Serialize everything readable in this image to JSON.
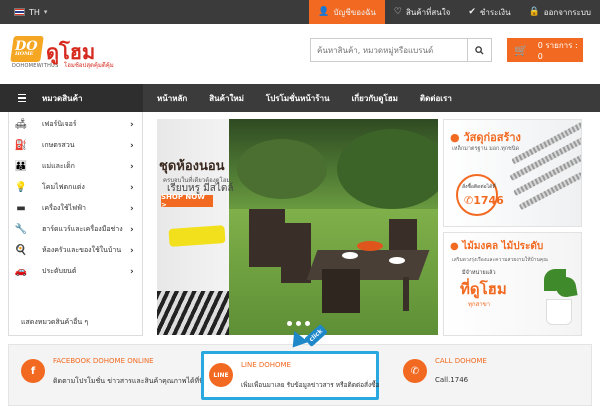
{
  "topbar": {
    "language": "TH",
    "links": [
      {
        "label": "บัญชีของฉัน",
        "icon": "user-icon"
      },
      {
        "label": "สินค้าที่สนใจ",
        "icon": "heart-icon"
      },
      {
        "label": "ชำระเงิน",
        "icon": "check-icon"
      },
      {
        "label": "ออกจากระบบ",
        "icon": "logout-icon"
      }
    ]
  },
  "header": {
    "logo_badge": "DO",
    "logo_badge_sub": "HOME",
    "logo_company": "DOHOMEWITHUS",
    "logo_main": "ดูโฮม",
    "logo_tagline": "โฮมช้อปสุดคุ้มดีคุ้ม",
    "search_placeholder": "ค้นหาสินค้า, หมวดหมู่หรือแบรนด์",
    "cart_label": "0 รายการ : 0"
  },
  "nav": {
    "category_label": "หมวดสินค้า",
    "items": [
      "หน้าหลัก",
      "สินค้าใหม่",
      "โปรโมชั่นหน้าร้าน",
      "เกี่ยวกับดูโฮม",
      "ติดต่อเรา"
    ]
  },
  "sidebar": {
    "categories": [
      {
        "label": "เฟอร์นิเจอร์",
        "icon": "sofa-icon"
      },
      {
        "label": "เกษตรสวน",
        "icon": "watering-can-icon"
      },
      {
        "label": "แม่และเด็ก",
        "icon": "mother-baby-icon"
      },
      {
        "label": "โคมไฟตกแต่ง",
        "icon": "lamp-icon"
      },
      {
        "label": "เครื่องใช้ไฟฟ้า",
        "icon": "appliance-icon"
      },
      {
        "label": "ฮาร์ดแวร์และเครื่องมือช่าง",
        "icon": "tools-icon"
      },
      {
        "label": "ห้องครัวและของใช้ในบ้าน",
        "icon": "kitchen-icon"
      },
      {
        "label": "ประดับยนต์",
        "icon": "car-icon"
      }
    ],
    "more_label": "แสดงหมวดสินค้าอื่น ๆ"
  },
  "hero": {
    "title": "ชุดห้องนอน",
    "lines": [
      "ครบจบในที่เดียวต้องดูโฮม",
      "เรียบหรู มีสไตล์"
    ],
    "button": "SHOP NOW >",
    "slide_count": 3
  },
  "banners": {
    "rebar": {
      "title": "วัสดุก่อสร้าง",
      "subtitle": "เหล็กมาตรฐาน มอก.ทุกชนิด",
      "order_label": "สั่งซื้อติดต่อได้ที่",
      "phone": "1746"
    },
    "plant": {
      "title": "ไม้มงคล ไม้ประดับ",
      "subtitle": "เสริมดวงรุ่งเรืองและความสวยงามให้บ้านคุณ",
      "have_label": "มีจำหน่ายแล้ว",
      "highlight": "ที่ดูโฮม",
      "branches": "ทุกสาขา"
    }
  },
  "contacts": [
    {
      "title": "FACEBOOK DOHOME ONLINE",
      "text": "ติดตามโปรโมชั่น ข่าวสารและสินค้าคุณภาพได้ที่นี่",
      "icon": "facebook-icon",
      "icon_glyph": "f"
    },
    {
      "title": "LINE DOHOME",
      "text": "เพิ่มเพื่อนมาเลย รับข้อมูลข่าวสาร หรือติดต่อสั่งซื้อ",
      "icon": "line-icon",
      "icon_glyph": "LINE"
    },
    {
      "title": "CALL DOHOME",
      "text": "Call.1746",
      "icon": "phone-icon",
      "icon_glyph": "✆"
    }
  ],
  "annotation": {
    "label": "click",
    "color": "#2aa8e0"
  },
  "colors": {
    "accent": "#f26a21",
    "dark_bar": "#3b3b3b",
    "logo_red": "#d62a1e"
  }
}
